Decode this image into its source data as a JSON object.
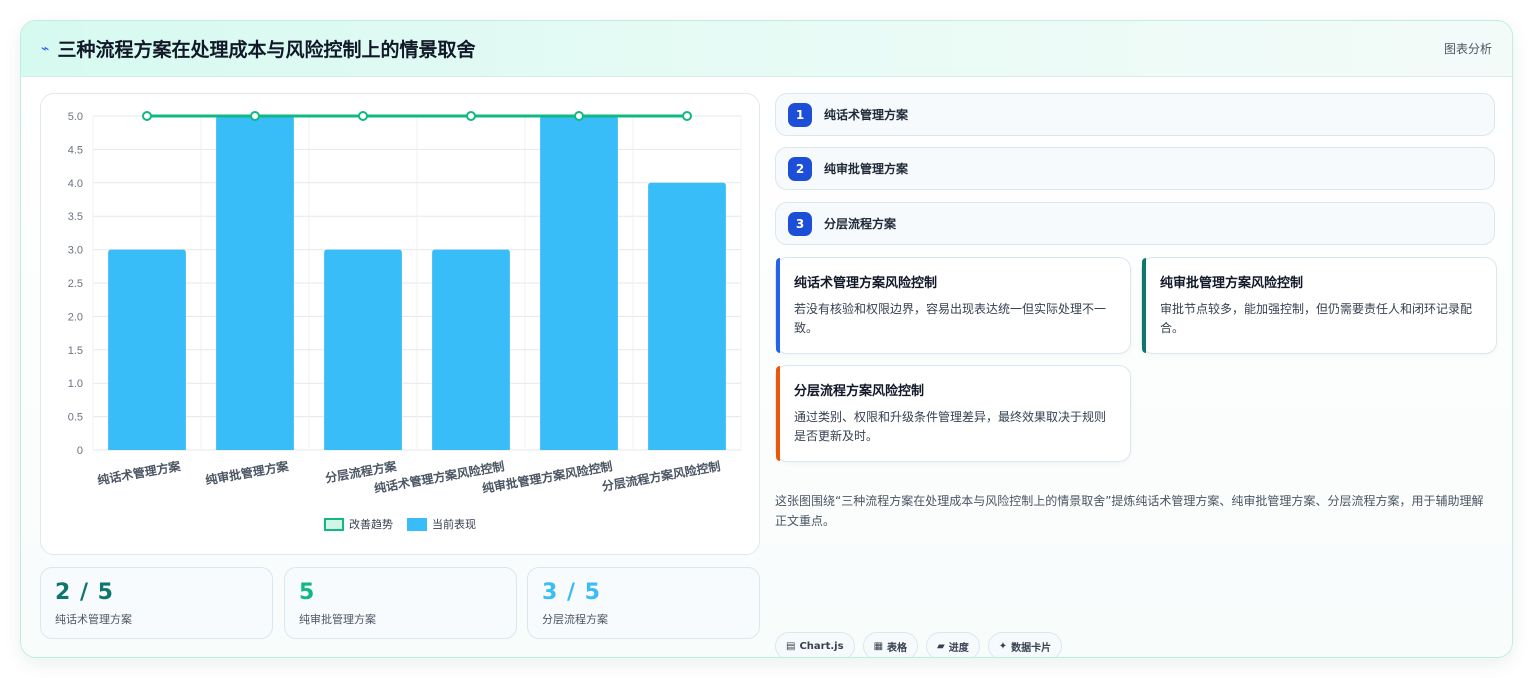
{
  "header": {
    "icon": "sparkle-icon",
    "title": "三种流程方案在处理成本与风险控制上的情景取舍",
    "tag": "图表分析"
  },
  "chart_data": {
    "type": "bar",
    "categories": [
      "纯话术管理方案",
      "纯审批管理方案",
      "分层流程方案",
      "纯话术管理方案风险控制",
      "纯审批管理方案风险控制",
      "分层流程方案风险控制"
    ],
    "series": [
      {
        "name": "改善趋势",
        "type": "line",
        "color": "#10b981",
        "values": [
          5,
          5,
          5,
          5,
          5,
          5
        ]
      },
      {
        "name": "当前表现",
        "type": "bar",
        "color": "#38bdf8",
        "values": [
          3,
          5,
          3,
          3,
          5,
          4
        ]
      }
    ],
    "ylim": [
      0,
      5
    ],
    "yticks": [
      "0",
      "0.5",
      "1.0",
      "1.5",
      "2.0",
      "2.5",
      "3.0",
      "3.5",
      "4.0",
      "4.5",
      "5.0"
    ],
    "legend_position": "bottom",
    "grid": true
  },
  "legend": {
    "line_label": "改善趋势",
    "bar_label": "当前表现"
  },
  "stats": [
    {
      "value": "2 / 5",
      "label": "纯话术管理方案",
      "color": "#0f766e"
    },
    {
      "value": "5",
      "label": "纯审批管理方案",
      "color": "#10b981"
    },
    {
      "value": "3 / 5",
      "label": "分层流程方案",
      "color": "#38bdf8"
    }
  ],
  "steps": [
    {
      "num": "1",
      "label": "纯话术管理方案"
    },
    {
      "num": "2",
      "label": "纯审批管理方案"
    },
    {
      "num": "3",
      "label": "分层流程方案"
    }
  ],
  "risk_cards": [
    {
      "title": "纯话术管理方案风险控制",
      "desc": "若没有核验和权限边界，容易出现表达统一但实际处理不一致。",
      "accent": "#2563eb"
    },
    {
      "title": "纯审批管理方案风险控制",
      "desc": "审批节点较多，能加强控制，但仍需要责任人和闭环记录配合。",
      "accent": "#0f766e"
    },
    {
      "title": "分层流程方案风险控制",
      "desc": "通过类别、权限和升级条件管理差异，最终效果取决于规则是否更新及时。",
      "accent": "#ea580c"
    }
  ],
  "summary": "这张图围绕“三种流程方案在处理成本与风险控制上的情景取舍”提炼纯话术管理方案、纯审批管理方案、分层流程方案，用于辅助理解正文重点。",
  "chips": [
    {
      "icon": "chart-icon",
      "glyph": "▤",
      "label": "Chart.js"
    },
    {
      "icon": "table-icon",
      "glyph": "▦",
      "label": "表格"
    },
    {
      "icon": "progress-icon",
      "glyph": "▰",
      "label": "进度"
    },
    {
      "icon": "card-icon",
      "glyph": "✦",
      "label": "数据卡片"
    }
  ]
}
